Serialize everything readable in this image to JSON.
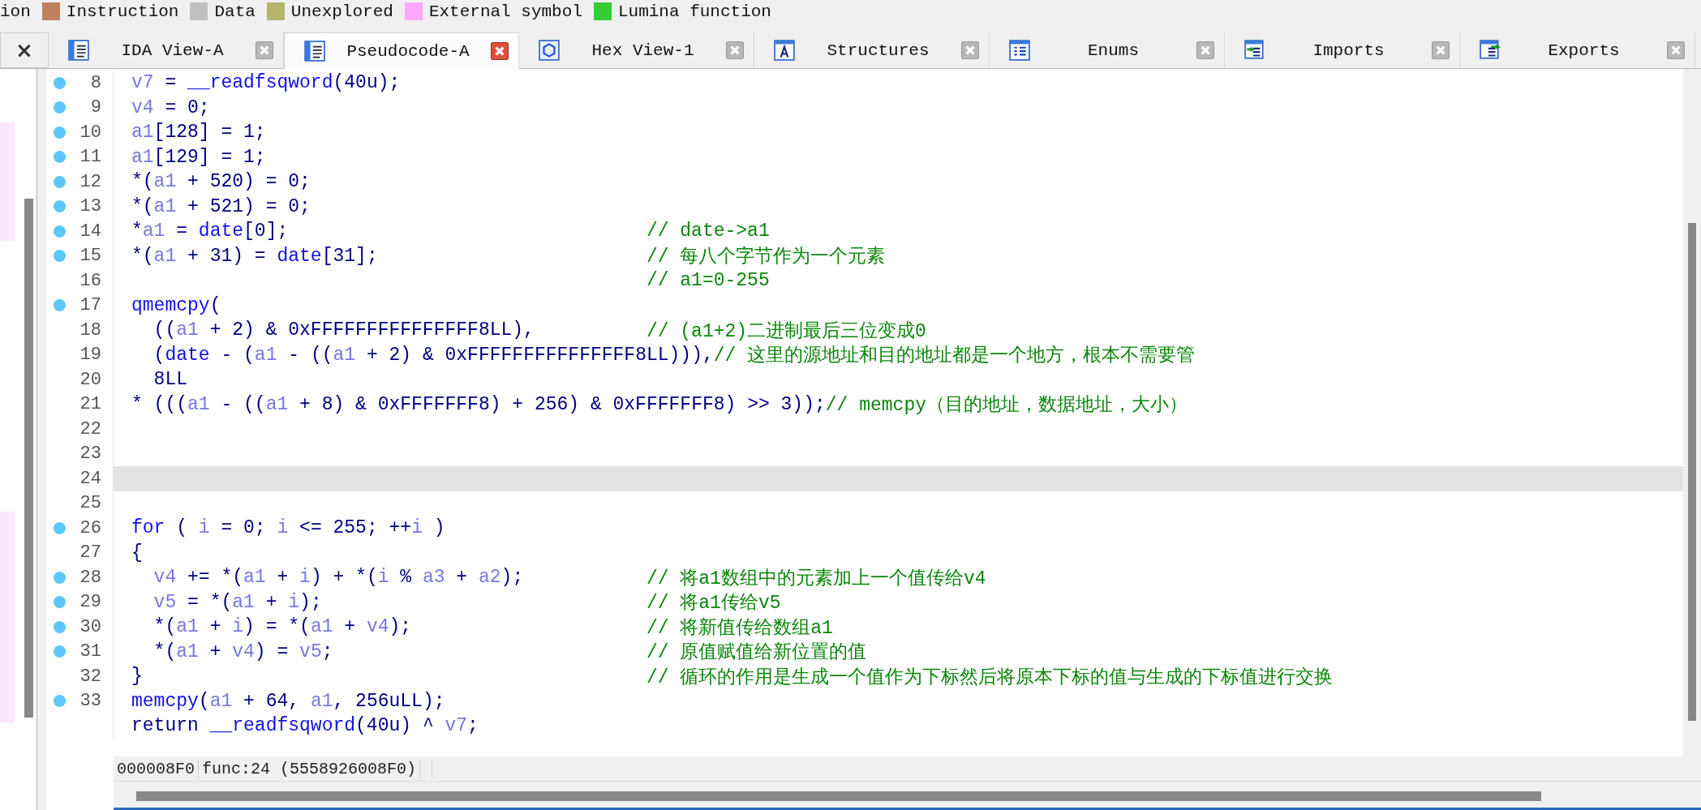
{
  "legend": [
    {
      "label": "ion"
    },
    {
      "label": "Instruction",
      "color": "#c0805c"
    },
    {
      "label": "Data",
      "color": "#c0c0c0"
    },
    {
      "label": "Unexplored",
      "color": "#b4b46c"
    },
    {
      "label": "External symbol",
      "color": "#ffa8ff"
    },
    {
      "label": "Lumina function",
      "color": "#33cc33"
    }
  ],
  "left_panel": {
    "close": "×"
  },
  "tabs": [
    {
      "label": "IDA View-A",
      "kind": "disassembly",
      "selected": false
    },
    {
      "label": "Pseudocode-A",
      "kind": "pseudocode",
      "selected": true
    },
    {
      "label": "Hex View-1",
      "kind": "hex",
      "selected": false
    },
    {
      "label": "Structures",
      "kind": "structures",
      "selected": false
    },
    {
      "label": "Enums",
      "kind": "enums",
      "selected": false
    },
    {
      "label": "Imports",
      "kind": "imports",
      "selected": false
    },
    {
      "label": "Exports",
      "kind": "exports",
      "selected": false
    }
  ],
  "editor": {
    "lines": [
      {
        "number": "8",
        "marker": true,
        "selected": false,
        "code": [
          {
            "kind": "var",
            "t": "v7"
          },
          {
            "kind": "plain",
            "t": " = "
          },
          {
            "kind": "name",
            "t": "__readfsqword"
          },
          {
            "kind": "plain",
            "t": "(40u);"
          }
        ]
      },
      {
        "number": "9",
        "marker": true,
        "selected": false,
        "code": [
          {
            "kind": "var",
            "t": "v4"
          },
          {
            "kind": "plain",
            "t": " = 0;"
          }
        ]
      },
      {
        "number": "10",
        "marker": true,
        "selected": false,
        "code": [
          {
            "kind": "var",
            "t": "a1"
          },
          {
            "kind": "plain",
            "t": "[128] = 1;"
          }
        ]
      },
      {
        "number": "11",
        "marker": true,
        "selected": false,
        "code": [
          {
            "kind": "var",
            "t": "a1"
          },
          {
            "kind": "plain",
            "t": "[129] = 1;"
          }
        ]
      },
      {
        "number": "12",
        "marker": true,
        "selected": false,
        "code": [
          {
            "kind": "plain",
            "t": "*("
          },
          {
            "kind": "var",
            "t": "a1"
          },
          {
            "kind": "plain",
            "t": " + 520) = 0;"
          }
        ]
      },
      {
        "number": "13",
        "marker": true,
        "selected": false,
        "code": [
          {
            "kind": "plain",
            "t": "*("
          },
          {
            "kind": "var",
            "t": "a1"
          },
          {
            "kind": "plain",
            "t": " + 521) = 0;"
          }
        ]
      },
      {
        "number": "14",
        "marker": true,
        "selected": false,
        "code": [
          {
            "kind": "plain",
            "t": "*"
          },
          {
            "kind": "var",
            "t": "a1"
          },
          {
            "kind": "plain",
            "t": " = "
          },
          {
            "kind": "name",
            "t": "date"
          },
          {
            "kind": "plain",
            "t": "[0];"
          }
        ],
        "comment": "// date->a1"
      },
      {
        "number": "15",
        "marker": true,
        "selected": false,
        "code": [
          {
            "kind": "plain",
            "t": "*("
          },
          {
            "kind": "var",
            "t": "a1"
          },
          {
            "kind": "plain",
            "t": " + 31) = "
          },
          {
            "kind": "name",
            "t": "date"
          },
          {
            "kind": "plain",
            "t": "[31];"
          }
        ],
        "comment": "// 每八个字节作为一个元素"
      },
      {
        "number": "16",
        "marker": false,
        "selected": false,
        "comment": "// a1=0-255"
      },
      {
        "number": "17",
        "marker": true,
        "selected": false,
        "code": [
          {
            "kind": "name",
            "t": "qmemcpy"
          },
          {
            "kind": "plain",
            "t": "("
          }
        ]
      },
      {
        "number": "18",
        "marker": false,
        "selected": false,
        "code": [
          {
            "kind": "plain",
            "t": "  (("
          },
          {
            "kind": "var",
            "t": "a1"
          },
          {
            "kind": "plain",
            "t": " + 2) & 0xFFFFFFFFFFFFFFF8LL),"
          }
        ],
        "comment": "// (a1+2)二进制最后三位变成0"
      },
      {
        "number": "19",
        "marker": false,
        "selected": false,
        "code": [
          {
            "kind": "plain",
            "t": "  ("
          },
          {
            "kind": "name",
            "t": "date"
          },
          {
            "kind": "plain",
            "t": " - ("
          },
          {
            "kind": "var",
            "t": "a1"
          },
          {
            "kind": "plain",
            "t": " - (("
          },
          {
            "kind": "var",
            "t": "a1"
          },
          {
            "kind": "plain",
            "t": " + 2) & 0xFFFFFFFFFFFFFFF8LL))),"
          }
        ],
        "comment": "// 这里的源地址和目的地址都是一个地方，根本不需要管"
      },
      {
        "number": "20",
        "marker": false,
        "selected": false,
        "code": [
          {
            "kind": "plain",
            "t": "  8LL"
          }
        ]
      },
      {
        "number": "21",
        "marker": false,
        "selected": false,
        "code": [
          {
            "kind": "plain",
            "t": "* ((("
          },
          {
            "kind": "var",
            "t": "a1"
          },
          {
            "kind": "plain",
            "t": " - (("
          },
          {
            "kind": "var",
            "t": "a1"
          },
          {
            "kind": "plain",
            "t": " + 8) & 0xFFFFFFF8) + 256) & 0xFFFFFFF8) >> 3));"
          }
        ],
        "comment": "// memcpy（目的地址，数据地址，大小）"
      },
      {
        "number": "22",
        "marker": false,
        "selected": false
      },
      {
        "number": "23",
        "marker": false,
        "selected": false
      },
      {
        "number": "24",
        "marker": false,
        "selected": true
      },
      {
        "number": "25",
        "marker": false,
        "selected": false
      },
      {
        "number": "26",
        "marker": true,
        "selected": false,
        "code": [
          {
            "kind": "name",
            "t": "for"
          },
          {
            "kind": "plain",
            "t": " ( "
          },
          {
            "kind": "var",
            "t": "i"
          },
          {
            "kind": "plain",
            "t": " = 0; "
          },
          {
            "kind": "var",
            "t": "i"
          },
          {
            "kind": "plain",
            "t": " <= 255; ++"
          },
          {
            "kind": "var",
            "t": "i"
          },
          {
            "kind": "plain",
            "t": " )"
          }
        ]
      },
      {
        "number": "27",
        "marker": false,
        "selected": false,
        "code": [
          {
            "kind": "plain",
            "t": "{"
          }
        ]
      },
      {
        "number": "28",
        "marker": true,
        "selected": false,
        "code": [
          {
            "kind": "var",
            "t": "  v4"
          },
          {
            "kind": "plain",
            "t": " += *("
          },
          {
            "kind": "var",
            "t": "a1"
          },
          {
            "kind": "plain",
            "t": " + "
          },
          {
            "kind": "var",
            "t": "i"
          },
          {
            "kind": "plain",
            "t": ") + *("
          },
          {
            "kind": "var",
            "t": "i"
          },
          {
            "kind": "plain",
            "t": " % "
          },
          {
            "kind": "var",
            "t": "a3"
          },
          {
            "kind": "plain",
            "t": " + "
          },
          {
            "kind": "var",
            "t": "a2"
          },
          {
            "kind": "plain",
            "t": ");"
          }
        ],
        "comment": "// 将a1数组中的元素加上一个值传给v4"
      },
      {
        "number": "29",
        "marker": true,
        "selected": false,
        "code": [
          {
            "kind": "var",
            "t": "  v5"
          },
          {
            "kind": "plain",
            "t": " = *("
          },
          {
            "kind": "var",
            "t": "a1"
          },
          {
            "kind": "plain",
            "t": " + "
          },
          {
            "kind": "var",
            "t": "i"
          },
          {
            "kind": "plain",
            "t": ");"
          }
        ],
        "comment": "// 将a1传给v5"
      },
      {
        "number": "30",
        "marker": true,
        "selected": false,
        "code": [
          {
            "kind": "plain",
            "t": "  *("
          },
          {
            "kind": "var",
            "t": "a1"
          },
          {
            "kind": "plain",
            "t": " + "
          },
          {
            "kind": "var",
            "t": "i"
          },
          {
            "kind": "plain",
            "t": ") = *("
          },
          {
            "kind": "var",
            "t": "a1"
          },
          {
            "kind": "plain",
            "t": " + "
          },
          {
            "kind": "var",
            "t": "v4"
          },
          {
            "kind": "plain",
            "t": ");"
          }
        ],
        "comment": "// 将新值传给数组a1"
      },
      {
        "number": "31",
        "marker": true,
        "selected": false,
        "code": [
          {
            "kind": "plain",
            "t": "  *("
          },
          {
            "kind": "var",
            "t": "a1"
          },
          {
            "kind": "plain",
            "t": " + "
          },
          {
            "kind": "var",
            "t": "v4"
          },
          {
            "kind": "plain",
            "t": ") = "
          },
          {
            "kind": "var",
            "t": "v5"
          },
          {
            "kind": "plain",
            "t": ";"
          }
        ],
        "comment": "// 原值赋值给新位置的值"
      },
      {
        "number": "32",
        "marker": false,
        "selected": false,
        "code": [
          {
            "kind": "plain",
            "t": "}"
          }
        ],
        "comment": "// 循环的作用是生成一个值作为下标然后将原本下标的值与生成的下标值进行交换"
      },
      {
        "number": "33",
        "marker": true,
        "selected": false,
        "code": [
          {
            "kind": "name",
            "t": "memcpy"
          },
          {
            "kind": "plain",
            "t": "("
          },
          {
            "kind": "var",
            "t": "a1"
          },
          {
            "kind": "plain",
            "t": " + 64, "
          },
          {
            "kind": "var",
            "t": "a1"
          },
          {
            "kind": "plain",
            "t": ", 256uLL);"
          }
        ]
      },
      {
        "marker": false,
        "selected": false,
        "code": [
          {
            "kind": "plain",
            "t": "return "
          },
          {
            "kind": "name",
            "t": "__readfsqword"
          },
          {
            "kind": "plain",
            "t": "(40u) ^ "
          },
          {
            "kind": "var",
            "t": "v7"
          },
          {
            "kind": "plain",
            "t": ";"
          }
        ]
      }
    ]
  },
  "status_bar": [
    "000008F0",
    "func:24 (5558926008F0)"
  ]
}
